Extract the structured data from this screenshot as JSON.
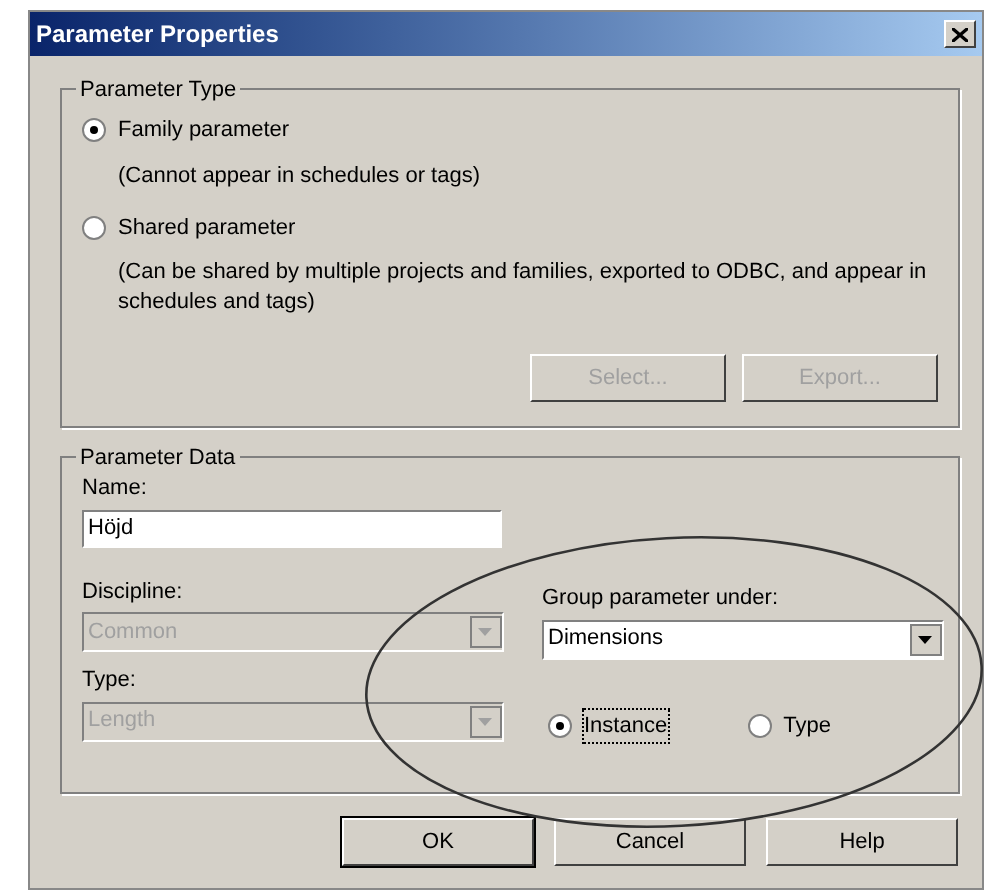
{
  "window": {
    "title": "Parameter Properties"
  },
  "parameter_type": {
    "title": "Parameter Type",
    "options": [
      {
        "label": "Family parameter",
        "description": "(Cannot appear in schedules or tags)",
        "selected": true
      },
      {
        "label": "Shared parameter",
        "description": "(Can be shared by multiple projects and families, exported to ODBC, and appear in schedules and tags)",
        "selected": false
      }
    ],
    "buttons": [
      {
        "label": "Select...",
        "disabled": true
      },
      {
        "label": "Export...",
        "disabled": true
      }
    ]
  },
  "parameter_data": {
    "title": "Parameter Data",
    "name": {
      "label": "Name:",
      "value": "Höjd"
    },
    "discipline": {
      "label": "Discipline:",
      "value": "Common",
      "disabled": true
    },
    "type": {
      "label": "Type:",
      "value": "Length",
      "disabled": true
    },
    "group": {
      "label": "Group parameter under:",
      "value": "Dimensions",
      "disabled": false
    },
    "binding": [
      {
        "label": "Instance",
        "selected": true
      },
      {
        "label": "Type",
        "selected": false
      }
    ]
  },
  "buttons": [
    {
      "label": "OK",
      "default": true
    },
    {
      "label": "Cancel",
      "default": false
    },
    {
      "label": "Help",
      "default": false
    }
  ]
}
